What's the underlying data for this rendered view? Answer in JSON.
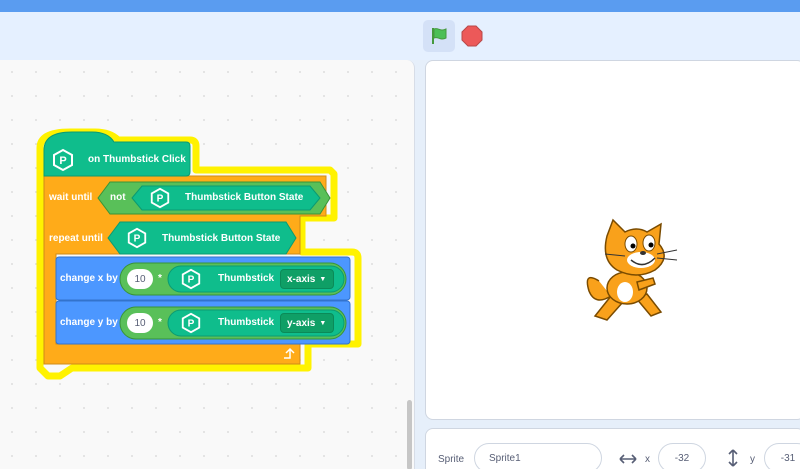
{
  "toolbar": {
    "flag_icon": "green-flag-icon",
    "stop_icon": "stop-icon"
  },
  "blocks": {
    "hat": {
      "label": "on Thumbstick Click"
    },
    "wait": {
      "label": "wait until",
      "not_label": "not",
      "reporter": "Thumbstick Button State"
    },
    "repeat": {
      "label": "repeat until",
      "reporter": "Thumbstick Button State"
    },
    "change_x": {
      "label": "change x by",
      "value": "10",
      "op": "*",
      "reporter": "Thumbstick",
      "axis": "x-axis"
    },
    "change_y": {
      "label": "change y by",
      "value": "10",
      "op": "*",
      "reporter": "Thumbstick",
      "axis": "y-axis"
    }
  },
  "sprite_info": {
    "sprite_label": "Sprite",
    "sprite_name": "Sprite1",
    "x_label": "x",
    "x_value": "-32",
    "y_label": "y",
    "y_value": "-31"
  },
  "colors": {
    "events_teal": "#0fbd8c",
    "control_orange": "#ffab19",
    "motion_blue": "#4c97ff",
    "operator_green": "#59c059",
    "highlight_yellow": "#fff200"
  }
}
